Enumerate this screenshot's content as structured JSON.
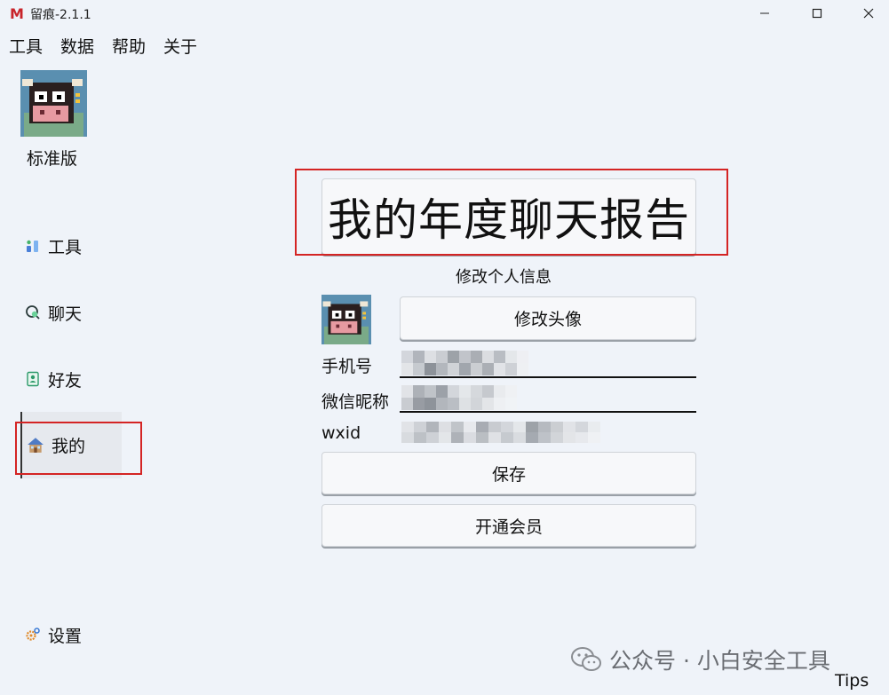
{
  "window": {
    "title": "留痕-2.1.1",
    "logo_glyph": "M",
    "logo_color": "#c8242b"
  },
  "menu": [
    "工具",
    "数据",
    "帮助",
    "关于"
  ],
  "sidebar": {
    "edition": "标准版",
    "items": [
      {
        "label": "工具",
        "icon": "tools-icon"
      },
      {
        "label": "聊天",
        "icon": "chat-icon"
      },
      {
        "label": "好友",
        "icon": "contacts-icon"
      },
      {
        "label": "我的",
        "icon": "home-icon",
        "active": true
      },
      {
        "label": "设置",
        "icon": "gear-icon"
      }
    ]
  },
  "main": {
    "report_button": "我的年度聊天报告",
    "section_title": "修改个人信息",
    "change_avatar": "修改头像",
    "fields": {
      "phone_label": "手机号",
      "nickname_label": "微信昵称",
      "wxid_label": "wxid"
    },
    "save": "保存",
    "vip": "开通会员"
  },
  "watermark": "公众号 · 小白安全工具",
  "tips": "Tips",
  "colors": {
    "highlight_box": "#d42424",
    "background": "#eff3f9"
  }
}
